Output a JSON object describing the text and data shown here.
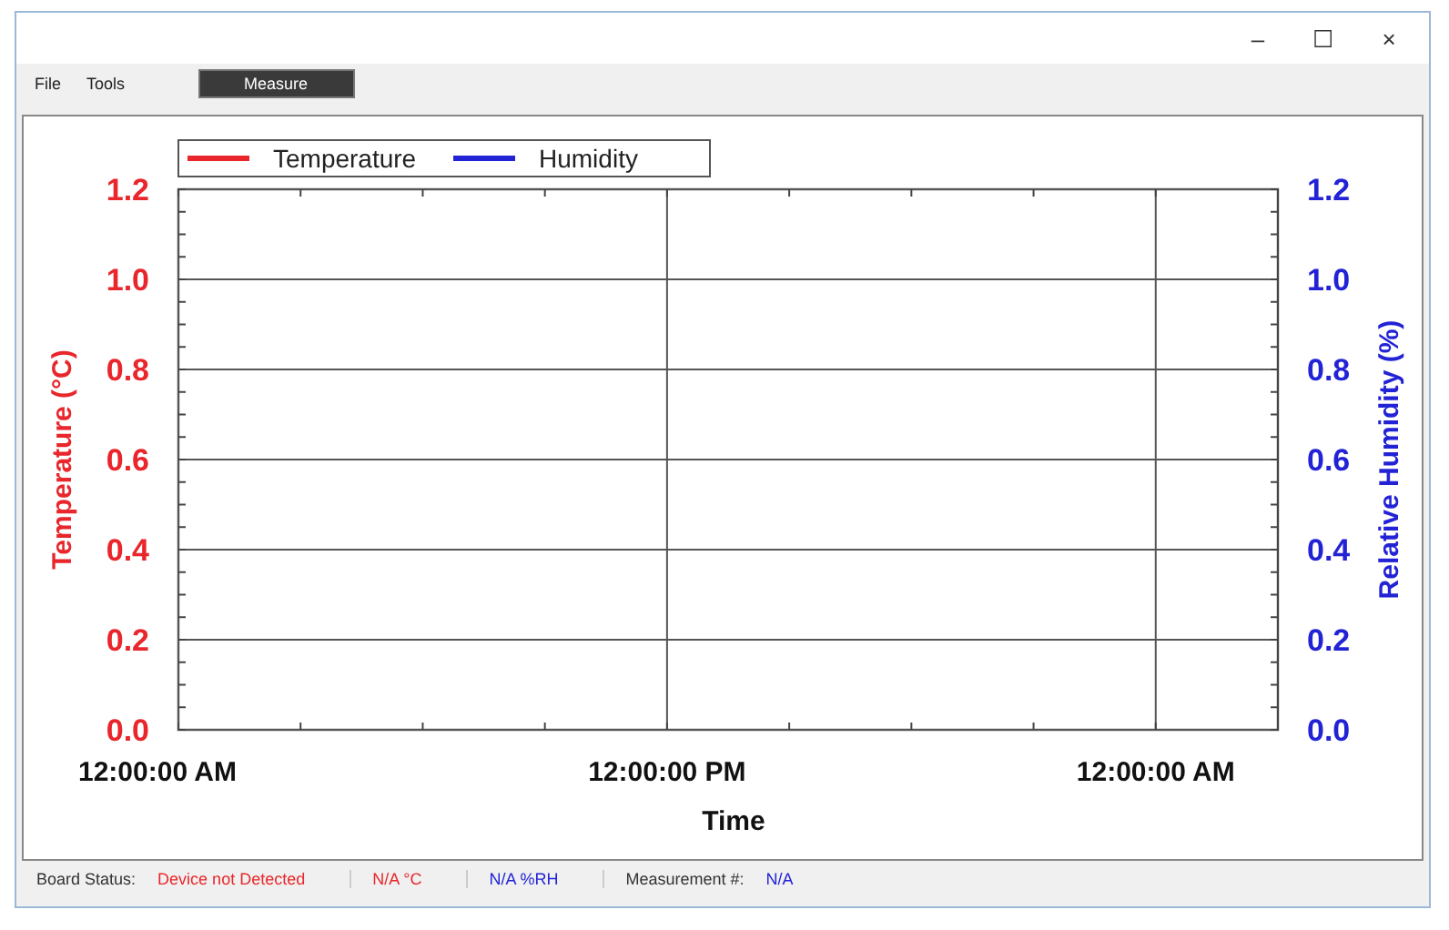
{
  "window": {
    "controls": [
      "–",
      "☐",
      "×"
    ]
  },
  "menu": [
    {
      "label": "File",
      "kind": "item",
      "selected": false
    },
    {
      "label": "Tools",
      "kind": "item",
      "selected": false
    },
    {
      "label": "Measure",
      "kind": "button",
      "selected": true
    }
  ],
  "chart_data": {
    "type": "line",
    "xlabel": "Time",
    "ylabel": "Temperature (°C)",
    "series": [
      {
        "name": "Temperature",
        "color": "#e8262b",
        "values": [
          null,
          null,
          null
        ]
      },
      {
        "name": "Humidity",
        "color": "#2323d6",
        "axis": "y2",
        "values": [
          null,
          null,
          null
        ]
      }
    ],
    "categories": [
      "12:00:00 AM",
      "12:00:00 PM",
      "12:00:00 AM"
    ],
    "ylim": [
      0,
      1.2
    ],
    "grid": true,
    "yticks": [
      {
        "value": 0,
        "label": "0.0"
      },
      {
        "value": 0.2,
        "label": "0.2"
      },
      {
        "value": 0.4,
        "label": "0.4"
      },
      {
        "value": 0.6,
        "label": "0.6"
      },
      {
        "value": 0.8,
        "label": "0.8"
      },
      {
        "value": 1,
        "label": "1.0"
      },
      {
        "value": 1.2,
        "label": "1.2"
      }
    ]
  },
  "right_axis": {
    "title": "Relative Humidity (%)",
    "ticks": [
      "1.2",
      "1.0",
      "0.8",
      "0.6",
      "0.4",
      "0.2",
      "0.0"
    ]
  },
  "status_bar": [
    {
      "label": "Board Status:",
      "color": "#333333"
    },
    {
      "label": "Device not Detected",
      "color": "#e8262b"
    },
    {
      "label": "N/A °C",
      "color": "#e8262b",
      "divider": true
    },
    {
      "label": "N/A %RH",
      "color": "#2323d6",
      "divider": true
    },
    {
      "label": "Measurement #:",
      "color": "#333333",
      "divider": true
    },
    {
      "label": "N/A",
      "color": "#2323d6"
    }
  ]
}
